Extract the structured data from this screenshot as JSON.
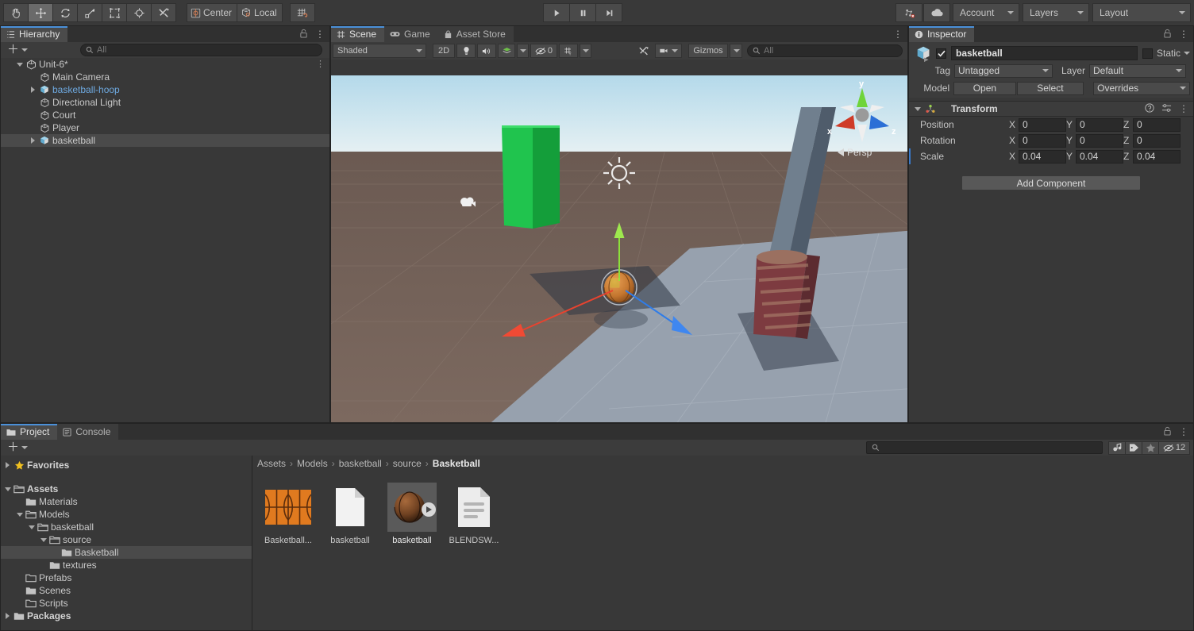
{
  "toolbar": {
    "tools": [
      {
        "name": "hand-tool",
        "icon": "hand",
        "active": false
      },
      {
        "name": "move-tool",
        "icon": "move",
        "active": true
      },
      {
        "name": "rotate-tool",
        "icon": "rotate",
        "active": false
      },
      {
        "name": "scale-tool",
        "icon": "scale",
        "active": false
      },
      {
        "name": "rect-tool",
        "icon": "rect",
        "active": false
      },
      {
        "name": "transform-tool",
        "icon": "transform",
        "active": false
      },
      {
        "name": "custom-tool",
        "icon": "wrench",
        "active": false
      }
    ],
    "pivot_label": "Center",
    "handle_label": "Local",
    "snap_label": "",
    "play_label": "play",
    "pause_label": "pause",
    "step_label": "step",
    "collab_label": "",
    "cloud_label": "",
    "account_label": "Account",
    "layers_label": "Layers",
    "layout_label": "Layout"
  },
  "hierarchy": {
    "tab_label": "Hierarchy",
    "search_placeholder": "All",
    "items": [
      {
        "label": "Unit-6*",
        "depth": 0,
        "arrow": "down",
        "icon": "scene-icon",
        "selected": false,
        "blue": false,
        "bold": false,
        "kebab": true
      },
      {
        "label": "Main Camera",
        "depth": 1,
        "arrow": "none",
        "icon": "gameobject-icon",
        "selected": false,
        "blue": false,
        "bold": false,
        "kebab": false
      },
      {
        "label": "basketball-hoop",
        "depth": 1,
        "arrow": "right",
        "icon": "prefab-icon",
        "selected": false,
        "blue": true,
        "bold": false,
        "kebab": false
      },
      {
        "label": "Directional Light",
        "depth": 1,
        "arrow": "none",
        "icon": "gameobject-icon",
        "selected": false,
        "blue": false,
        "bold": false,
        "kebab": false
      },
      {
        "label": "Court",
        "depth": 1,
        "arrow": "none",
        "icon": "gameobject-icon",
        "selected": false,
        "blue": false,
        "bold": false,
        "kebab": false
      },
      {
        "label": "Player",
        "depth": 1,
        "arrow": "none",
        "icon": "gameobject-icon",
        "selected": false,
        "blue": false,
        "bold": false,
        "kebab": false
      },
      {
        "label": "basketball",
        "depth": 1,
        "arrow": "right",
        "icon": "prefab-icon",
        "selected": true,
        "blue": false,
        "bold": false,
        "kebab": false
      }
    ]
  },
  "scene": {
    "tabs": [
      {
        "label": "Scene",
        "icon": "grid-icon",
        "active": true
      },
      {
        "label": "Game",
        "icon": "gamepad-icon",
        "active": false
      },
      {
        "label": "Asset Store",
        "icon": "store-icon",
        "active": false
      }
    ],
    "draw_mode": "Shaded",
    "mode_2d": "2D",
    "lighting_icon": "lightbulb-icon",
    "audio_icon": "speaker-icon",
    "fx_icon": "effects-icon",
    "hidden_count": "0",
    "grid_icon": "grid-visibility-icon",
    "tools_icon": "scene-tools-icon",
    "camera_icon": "scene-camera-icon",
    "gizmos_label": "Gizmos",
    "search_placeholder": "All",
    "gizmo": {
      "x": "x",
      "y": "y",
      "z": "z",
      "projection": "Persp"
    },
    "colors": {
      "sky_top": "#b9dcea",
      "sky_horizon": "#e2eef2",
      "ground": "#6e5c53",
      "court": "#9aa5b1",
      "hoop_pole": "#1fc24a",
      "player_pole": "#6d7b8a",
      "player_base": "#7a3a3e",
      "ball": "#c97a35",
      "gizmo_x": "#e8432f",
      "gizmo_y": "#8ce03a",
      "gizmo_z": "#2f7ce8"
    }
  },
  "inspector": {
    "tab_label": "Inspector",
    "object_name": "basketball",
    "enabled": true,
    "static_label": "Static",
    "tag_label": "Tag",
    "tag_value": "Untagged",
    "layer_label": "Layer",
    "layer_value": "Default",
    "model_label": "Model",
    "open_label": "Open",
    "select_label": "Select",
    "overrides_label": "Overrides",
    "transform": {
      "title": "Transform",
      "rows": [
        {
          "label": "Position",
          "x": "0",
          "y": "0",
          "z": "0"
        },
        {
          "label": "Rotation",
          "x": "0",
          "y": "0",
          "z": "0"
        },
        {
          "label": "Scale",
          "x": "0.04",
          "y": "0.04",
          "z": "0.04"
        }
      ],
      "axis_labels": [
        "X",
        "Y",
        "Z"
      ]
    },
    "add_component_label": "Add Component"
  },
  "project": {
    "tabs": [
      {
        "label": "Project",
        "icon": "folder-icon",
        "active": true
      },
      {
        "label": "Console",
        "icon": "console-icon",
        "active": false
      }
    ],
    "search_value": "",
    "hidden_count": "12",
    "breadcrumb": [
      "Assets",
      "Models",
      "basketball",
      "source",
      "Basketball"
    ],
    "tree": [
      {
        "label": "Favorites",
        "depth": 0,
        "arrow": "right",
        "icon": "star-icon",
        "selected": false,
        "bold": true
      },
      {
        "label": "Assets",
        "depth": 0,
        "arrow": "down",
        "icon": "folder-open-icon",
        "selected": false,
        "bold": true
      },
      {
        "label": "Materials",
        "depth": 1,
        "arrow": "none",
        "icon": "folder-icon",
        "selected": false,
        "bold": false
      },
      {
        "label": "Models",
        "depth": 1,
        "arrow": "down",
        "icon": "folder-open-icon",
        "selected": false,
        "bold": false
      },
      {
        "label": "basketball",
        "depth": 2,
        "arrow": "down",
        "icon": "folder-open-icon",
        "selected": false,
        "bold": false
      },
      {
        "label": "source",
        "depth": 3,
        "arrow": "down",
        "icon": "folder-open-icon",
        "selected": false,
        "bold": false
      },
      {
        "label": "Basketball",
        "depth": 4,
        "arrow": "none",
        "icon": "folder-icon",
        "selected": true,
        "bold": false
      },
      {
        "label": "textures",
        "depth": 3,
        "arrow": "none",
        "icon": "folder-icon",
        "selected": false,
        "bold": false
      },
      {
        "label": "Prefabs",
        "depth": 1,
        "arrow": "none",
        "icon": "folder-empty-icon",
        "selected": false,
        "bold": false
      },
      {
        "label": "Scenes",
        "depth": 1,
        "arrow": "none",
        "icon": "folder-icon",
        "selected": false,
        "bold": false
      },
      {
        "label": "Scripts",
        "depth": 1,
        "arrow": "none",
        "icon": "folder-empty-icon",
        "selected": false,
        "bold": false
      },
      {
        "label": "Packages",
        "depth": 0,
        "arrow": "right",
        "icon": "folder-icon",
        "selected": false,
        "bold": true
      }
    ],
    "assets": [
      {
        "label": "Basketball...",
        "icon": "texture-icon",
        "selected": false
      },
      {
        "label": "basketball",
        "icon": "file-icon",
        "selected": false
      },
      {
        "label": "basketball",
        "icon": "model-preview-icon",
        "selected": true
      },
      {
        "label": "BLENDSW...",
        "icon": "text-file-icon",
        "selected": false
      }
    ]
  }
}
